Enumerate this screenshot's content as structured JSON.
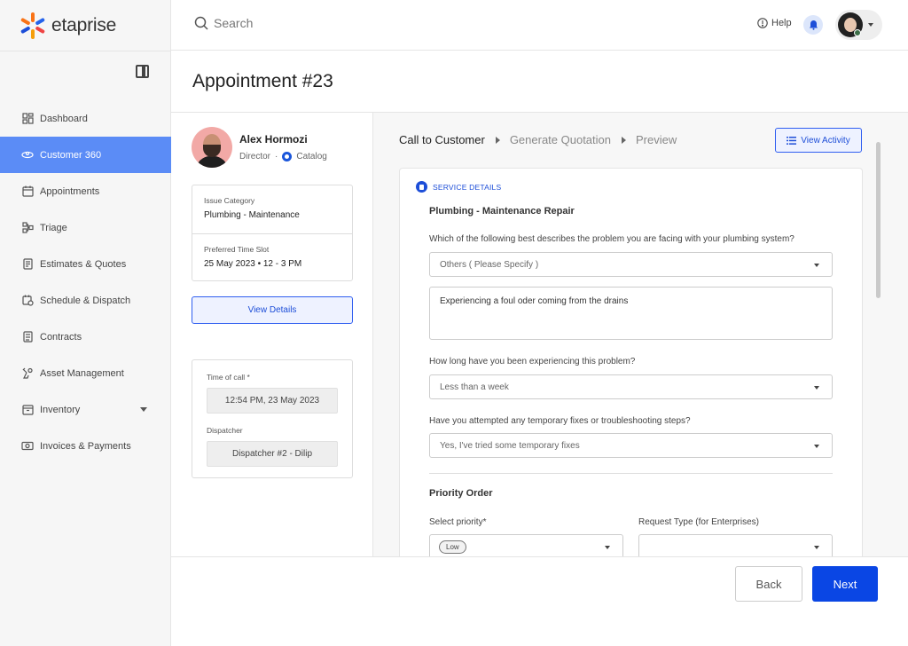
{
  "app": {
    "name": "etaprise"
  },
  "header": {
    "search_placeholder": "Search",
    "help_label": "Help"
  },
  "sidebar": {
    "items": [
      {
        "label": "Dashboard",
        "icon": "dashboard-icon"
      },
      {
        "label": "Customer 360",
        "icon": "customer-360-icon",
        "active": true
      },
      {
        "label": "Appointments",
        "icon": "calendar-icon"
      },
      {
        "label": "Triage",
        "icon": "triage-icon"
      },
      {
        "label": "Estimates & Quotes",
        "icon": "estimates-icon"
      },
      {
        "label": "Schedule & Dispatch",
        "icon": "schedule-icon"
      },
      {
        "label": "Contracts",
        "icon": "contracts-icon"
      },
      {
        "label": "Asset Management",
        "icon": "asset-icon"
      },
      {
        "label": "Inventory",
        "icon": "inventory-icon"
      },
      {
        "label": "Invoices & Payments",
        "icon": "invoices-icon"
      }
    ]
  },
  "page": {
    "title": "Appointment #23"
  },
  "customer": {
    "name": "Alex Hormozi",
    "role": "Director",
    "separator": "·",
    "org": "Catalog",
    "issue_category_label": "Issue Category",
    "issue_category_value": "Plumbing - Maintenance",
    "time_slot_label": "Preferred Time Slot",
    "time_slot_value": "25 May 2023 • 12 - 3 PM",
    "view_details_label": "View Details",
    "time_of_call_label": "Time of call *",
    "time_of_call_value": "12:54 PM, 23 May 2023",
    "dispatcher_label": "Dispatcher",
    "dispatcher_value": "Dispatcher #2 - Dilip"
  },
  "steps": [
    "Call to Customer",
    "Generate Quotation",
    "Preview"
  ],
  "view_activity_label": "View Activity",
  "form": {
    "section_tag": "SERVICE DETAILS",
    "heading": "Plumbing - Maintenance Repair",
    "q1": "Which of the following best describes the problem you are facing with your plumbing system?",
    "a1": "Others ( Please Specify )",
    "a1_detail": "Experiencing a foul oder coming from the drains",
    "q2": "How long have you been experiencing this problem?",
    "a2": "Less than a week",
    "q3": "Have you attempted any temporary fixes or troubleshooting steps?",
    "a3": "Yes, I've tried some temporary fixes",
    "priority_heading": "Priority Order",
    "priority_label": "Select priority*",
    "priority_value": "Low",
    "request_type_label": "Request Type (for Enterprises)",
    "request_type_value": ""
  },
  "footer": {
    "back_label": "Back",
    "next_label": "Next"
  },
  "colors": {
    "accent": "#0a46e4",
    "sidebar_active": "#5b8cf6",
    "link": "#1d4ed8"
  }
}
